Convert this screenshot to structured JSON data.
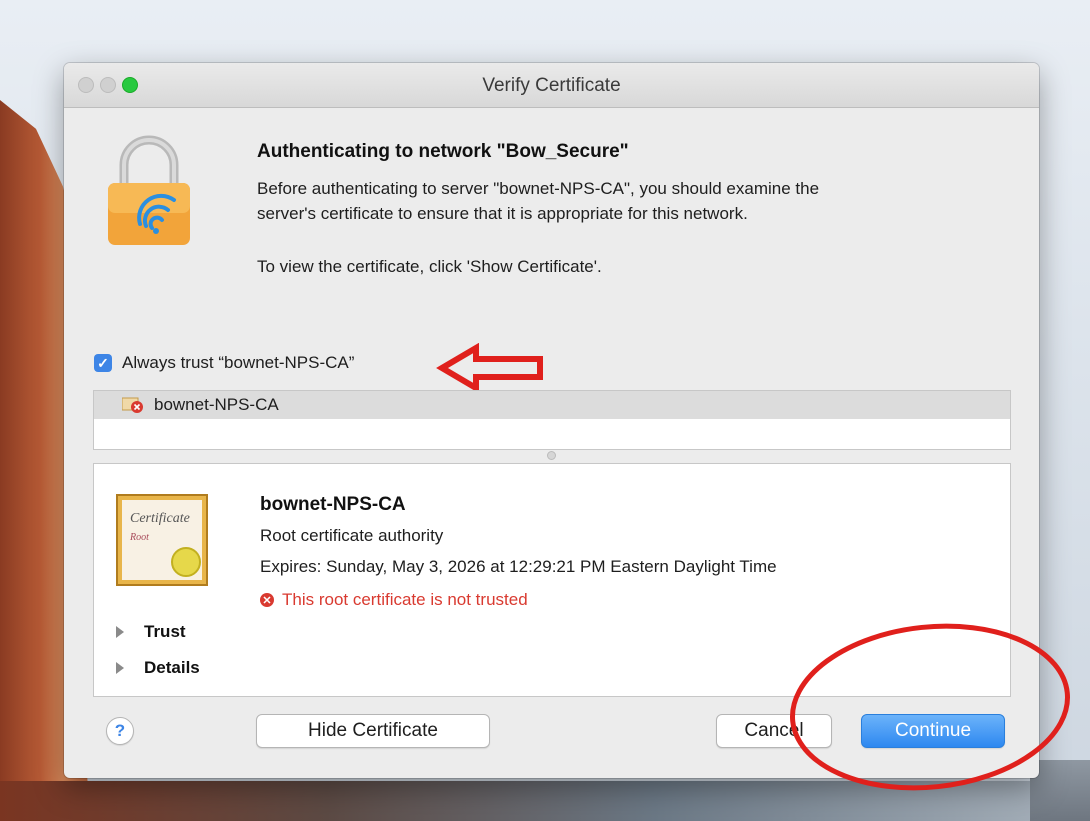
{
  "window": {
    "title": "Verify Certificate"
  },
  "message": {
    "heading": "Authenticating to network \"Bow_Secure\"",
    "line1": "Before authenticating to server \"bownet-NPS-CA\", you should examine the",
    "line2": "server's certificate to ensure that it is appropriate for this network.",
    "hint": "To view the certificate, click 'Show Certificate'."
  },
  "trust_checkbox": {
    "label": "Always trust “bownet-NPS-CA”",
    "checked": true
  },
  "cert_list": {
    "items": [
      {
        "label": "bownet-NPS-CA"
      }
    ]
  },
  "cert_detail": {
    "name": "bownet-NPS-CA",
    "type": "Root certificate authority",
    "expires": "Expires: Sunday, May 3, 2026 at 12:29:21 PM Eastern Daylight Time",
    "warning": "This root certificate is not trusted",
    "image_text_1": "Certificate",
    "image_text_2": "Root",
    "sections": [
      {
        "label": "Trust"
      },
      {
        "label": "Details"
      }
    ]
  },
  "buttons": {
    "help": "?",
    "hide_certificate": "Hide Certificate",
    "cancel": "Cancel",
    "continue": "Continue"
  },
  "colors": {
    "accent": "#3d85e6",
    "warning": "#d93a30",
    "annotation": "#e0201c"
  }
}
